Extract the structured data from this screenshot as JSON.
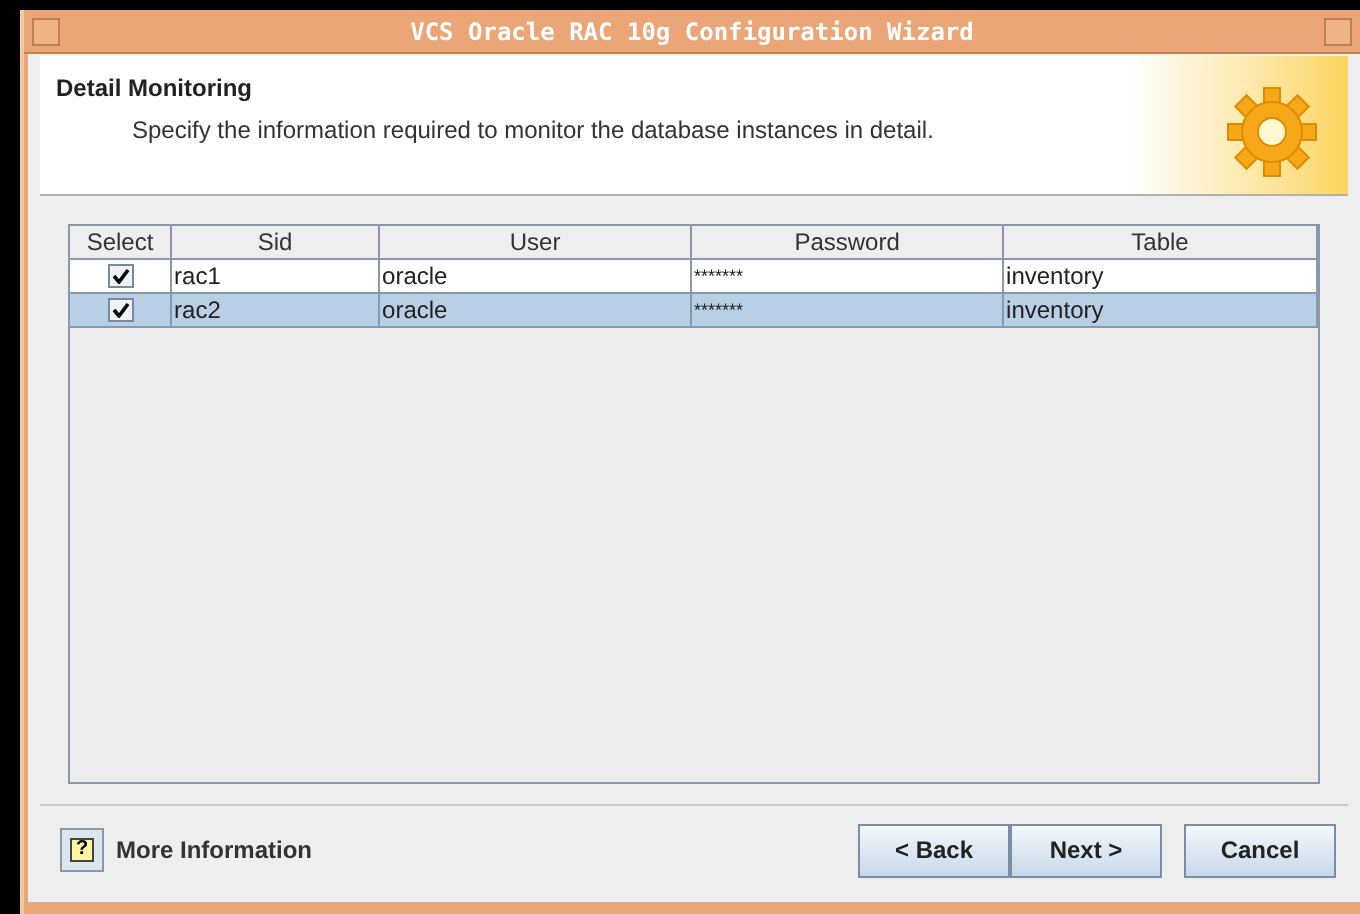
{
  "window": {
    "title": "VCS Oracle RAC 10g Configuration Wizard"
  },
  "header": {
    "title": "Detail Monitoring",
    "description": "Specify the information required to monitor the database instances in detail."
  },
  "table": {
    "columns": [
      "Select",
      "Sid",
      "User",
      "Password",
      "Table"
    ],
    "rows": [
      {
        "checked": true,
        "selected": false,
        "sid": "rac1",
        "user": "oracle",
        "password": "*******",
        "table": "inventory"
      },
      {
        "checked": true,
        "selected": true,
        "sid": "rac2",
        "user": "oracle",
        "password": "*******",
        "table": "inventory"
      }
    ]
  },
  "footer": {
    "help_icon": "?",
    "more_info": "More Information",
    "buttons": [
      "< Back",
      "Next >",
      "Cancel"
    ]
  }
}
